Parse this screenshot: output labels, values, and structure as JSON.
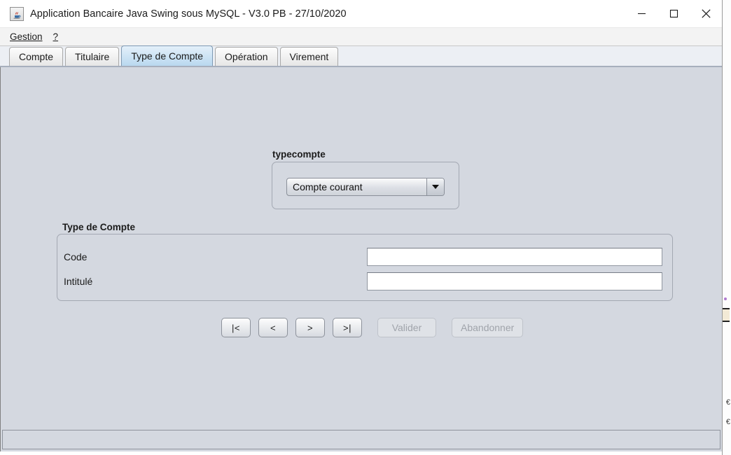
{
  "window": {
    "title": "Application Bancaire Java Swing sous MySQL - V3.0 PB - 27/10/2020",
    "icon": "java-coffee-cup-icon",
    "controls": {
      "minimize": "minimize-icon",
      "maximize": "maximize-icon",
      "close": "close-icon"
    }
  },
  "menubar": {
    "items": [
      {
        "label": "Gestion",
        "mnemonic": "G"
      },
      {
        "label": "?",
        "mnemonic": "?"
      }
    ]
  },
  "tabs": [
    {
      "label": "Compte",
      "selected": false
    },
    {
      "label": "Titulaire",
      "selected": false
    },
    {
      "label": "Type de Compte",
      "selected": true
    },
    {
      "label": "Opération",
      "selected": false
    },
    {
      "label": "Virement",
      "selected": false
    }
  ],
  "typecompte_group": {
    "title": "typecompte",
    "combo": {
      "value": "Compte courant",
      "arrow": "chevron-down-icon"
    }
  },
  "form_group": {
    "title": "Type de Compte",
    "fields": [
      {
        "label": "Code",
        "value": "",
        "placeholder": ""
      },
      {
        "label": "Intitulé",
        "value": "",
        "placeholder": ""
      }
    ]
  },
  "buttons": [
    {
      "label": "|<",
      "name": "first-record-button",
      "disabled": false
    },
    {
      "label": "<",
      "name": "previous-record-button",
      "disabled": false
    },
    {
      "label": ">",
      "name": "next-record-button",
      "disabled": false
    },
    {
      "label": ">|",
      "name": "last-record-button",
      "disabled": false
    },
    {
      "label": "Valider",
      "name": "validate-button",
      "disabled": true
    },
    {
      "label": "Abandonner",
      "name": "cancel-button",
      "disabled": true
    }
  ],
  "colors": {
    "content_background": "#d4d8e0",
    "selected_tab": "#b9d8ef",
    "panel_border": "#a3a8b2",
    "field_background": "#ffffff",
    "disabled_text": "#a0a4ab"
  }
}
